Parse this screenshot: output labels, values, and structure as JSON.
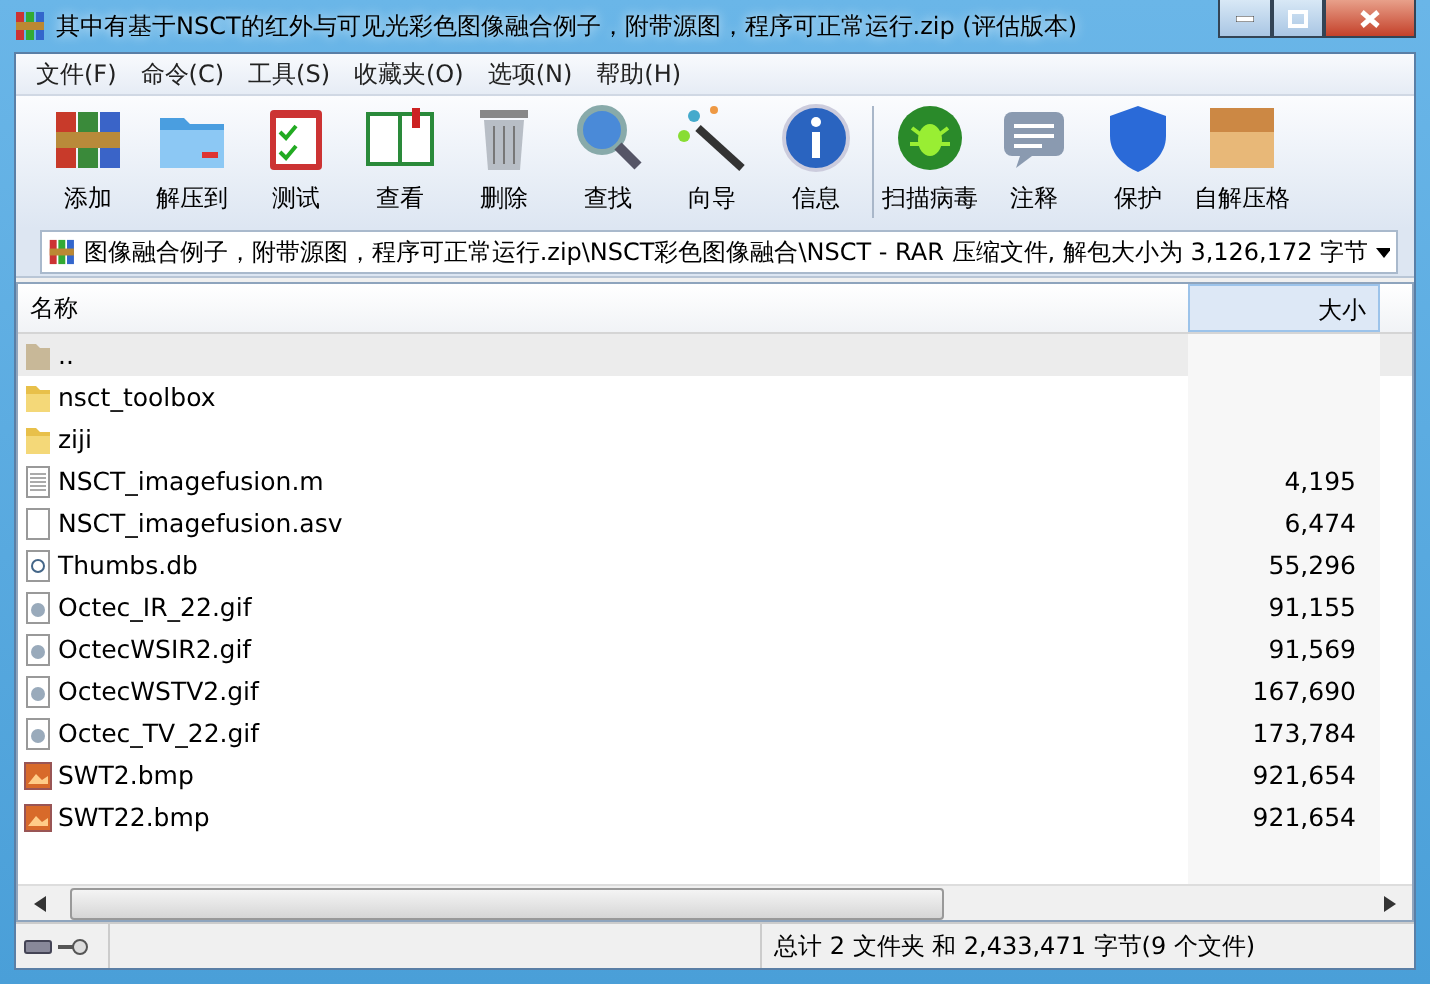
{
  "window": {
    "title": "其中有基于NSCT的红外与可见光彩色图像融合例子，附带源图，程序可正常运行.zip (评估版本)"
  },
  "menu": [
    "文件(F)",
    "命令(C)",
    "工具(S)",
    "收藏夹(O)",
    "选项(N)",
    "帮助(H)"
  ],
  "toolbar": [
    {
      "kind": "books",
      "label": "添加"
    },
    {
      "kind": "folder",
      "label": "解压到"
    },
    {
      "kind": "clipboard",
      "label": "测试"
    },
    {
      "kind": "book",
      "label": "查看"
    },
    {
      "kind": "trash",
      "label": "删除"
    },
    {
      "kind": "magnifier",
      "label": "查找"
    },
    {
      "kind": "wand",
      "label": "向导"
    },
    {
      "kind": "info",
      "label": "信息"
    },
    {
      "kind": "bug",
      "label": "扫描病毒"
    },
    {
      "kind": "note",
      "label": "注释"
    },
    {
      "kind": "shield",
      "label": "保护"
    },
    {
      "kind": "box",
      "label": "自解压格"
    }
  ],
  "address": "图像融合例子，附带源图，程序可正常运行.zip\\NSCT彩色图像融合\\NSCT - RAR 压缩文件, 解包大小为 3,126,172 字节",
  "table": {
    "columns": [
      "名称",
      "大小"
    ],
    "rows": [
      {
        "kind": "up",
        "name": "..",
        "size": "",
        "selected": true
      },
      {
        "kind": "folder",
        "name": "nsct_toolbox",
        "size": "",
        "selected": false
      },
      {
        "kind": "folder",
        "name": "ziji",
        "size": "",
        "selected": false
      },
      {
        "kind": "text",
        "name": "NSCT_imagefusion.m",
        "size": "4,195",
        "selected": false
      },
      {
        "kind": "blank",
        "name": "NSCT_imagefusion.asv",
        "size": "6,474",
        "selected": false
      },
      {
        "kind": "db",
        "name": "Thumbs.db",
        "size": "55,296",
        "selected": false
      },
      {
        "kind": "gif",
        "name": "Octec_IR_22.gif",
        "size": "91,155",
        "selected": false
      },
      {
        "kind": "gif",
        "name": "OctecWSIR2.gif",
        "size": "91,569",
        "selected": false
      },
      {
        "kind": "gif",
        "name": "OctecWSTV2.gif",
        "size": "167,690",
        "selected": false
      },
      {
        "kind": "gif",
        "name": "Octec_TV_22.gif",
        "size": "173,784",
        "selected": false
      },
      {
        "kind": "bmp",
        "name": "SWT2.bmp",
        "size": "921,654",
        "selected": false
      },
      {
        "kind": "bmp",
        "name": "SWT22.bmp",
        "size": "921,654",
        "selected": false
      }
    ]
  },
  "status_bar": "总计 2 文件夹 和 2,433,471 字节(9 个文件)"
}
